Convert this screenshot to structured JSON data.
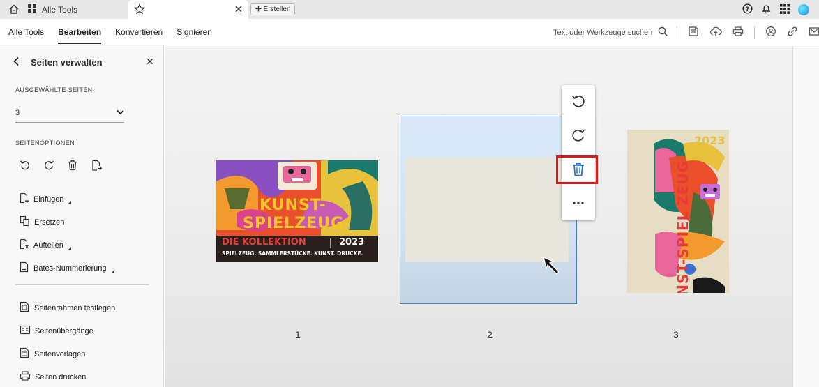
{
  "tabbar": {
    "alltools_tab": "Alle Tools",
    "create_label": "Erstellen"
  },
  "menu": {
    "items": [
      "Alle Tools",
      "Bearbeiten",
      "Konvertieren",
      "Signieren"
    ],
    "active": "Bearbeiten",
    "search_placeholder": "Text oder Werkzeuge suchen"
  },
  "sidebar": {
    "title": "Seiten verwalten",
    "selected_pages_label": "AUSGEWÄHLTE SEITEN",
    "selected_value": "3",
    "page_options_label": "SEITENOPTIONEN",
    "options": [
      {
        "label": "Einfügen",
        "icon": "insert-page-icon",
        "submenu": true
      },
      {
        "label": "Ersetzen",
        "icon": "replace-page-icon",
        "submenu": false
      },
      {
        "label": "Aufteilen",
        "icon": "split-page-icon",
        "submenu": true
      },
      {
        "label": "Bates-Nummerierung",
        "icon": "bates-icon",
        "submenu": true
      }
    ],
    "more_options": [
      {
        "label": "Seitenrahmen festlegen",
        "icon": "page-box-icon"
      },
      {
        "label": "Seitenübergänge",
        "icon": "page-transitions-icon"
      },
      {
        "label": "Seitenvorlagen",
        "icon": "page-templates-icon"
      },
      {
        "label": "Seiten drucken",
        "icon": "print-pages-icon"
      }
    ]
  },
  "pages": [
    {
      "number": "1"
    },
    {
      "number": "2"
    },
    {
      "number": "3"
    }
  ],
  "thumb1": {
    "title_line1": "KUNST-",
    "title_line2": "SPIELZEUG",
    "subtitle": "DIE KOLLEKTION",
    "year": "2023",
    "tagline": "SPIELZEUG. SAMMLERSTÜCKE. KUNST. DRUCKE."
  },
  "thumb3": {
    "vertical_text": "KUNST-SPIEL ZEUG",
    "year": "2023"
  },
  "colors": {
    "accent": "#4a7fc1",
    "highlight": "#e01a1a",
    "trash": "#1f6fd6"
  }
}
